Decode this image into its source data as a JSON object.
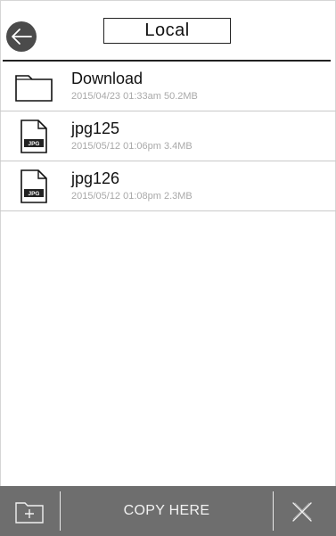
{
  "header": {
    "title": "Local"
  },
  "files": [
    {
      "name": "Download",
      "meta": "2015/04/23 01:33am 50.2MB",
      "icon": "folder-icon"
    },
    {
      "name": "jpg125",
      "meta": "2015/05/12 01:06pm 3.4MB",
      "icon": "jpg-file-icon",
      "badge": "JPG"
    },
    {
      "name": "jpg126",
      "meta": "2015/05/12 01:08pm 2.3MB",
      "icon": "jpg-file-icon",
      "badge": "JPG"
    }
  ],
  "toolbar": {
    "copy_label": "COPY HERE"
  },
  "colors": {
    "back_button": "#4b4b4b",
    "toolbar_bg": "#6e6e6e",
    "meta_text": "#a9a9a9"
  }
}
